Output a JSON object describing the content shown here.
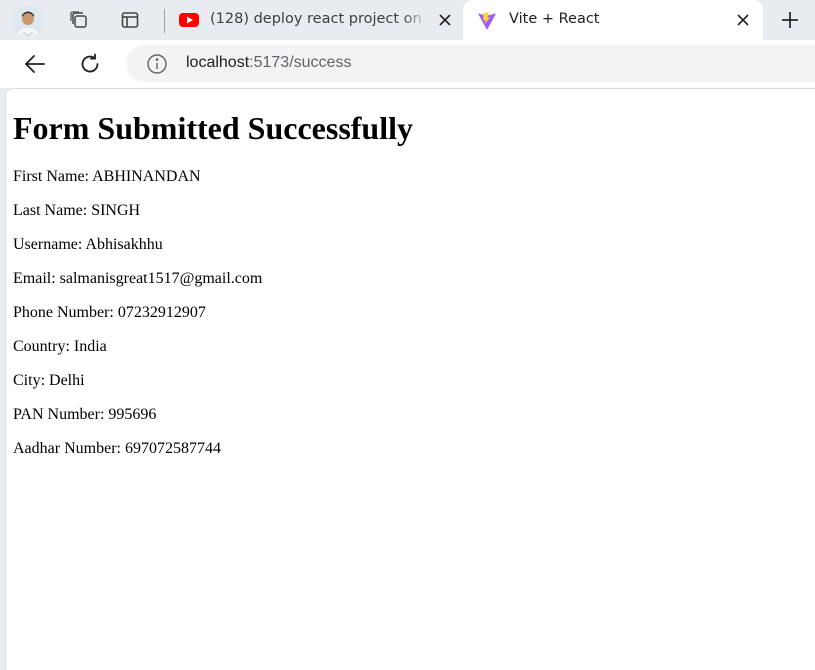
{
  "browser": {
    "tabs": [
      {
        "title": "(128) deploy react project on github pages",
        "favicon": "youtube-icon",
        "active": false
      },
      {
        "title": "Vite + React",
        "favicon": "vite-icon",
        "active": true
      }
    ],
    "address_bar": {
      "host": "localhost",
      "rest": ":5173/success"
    },
    "icons": {
      "profile": "avatar",
      "workspaces": "workspaces-icon",
      "tab_actions": "tab-actions-icon",
      "back": "back-arrow-icon",
      "reload": "reload-icon",
      "site_info": "info-icon",
      "close": "close-icon",
      "new_tab": "plus-icon"
    },
    "colors": {
      "tabstrip": "#e8ebef",
      "youtube_red": "#ff0000",
      "vite_purple": "#9d5cff",
      "vite_yellow": "#ffd62e"
    }
  },
  "page": {
    "heading": "Form Submitted Successfully",
    "fields": [
      {
        "label": "First Name",
        "value": "ABHINANDAN",
        "text": "First Name: ABHINANDAN"
      },
      {
        "label": "Last Name",
        "value": "SINGH",
        "text": "Last Name: SINGH"
      },
      {
        "label": "Username",
        "value": "Abhisakhhu",
        "text": "Username: Abhisakhhu"
      },
      {
        "label": "Email",
        "value": "salmanisgreat1517@gmail.com",
        "text": "Email: salmanisgreat1517@gmail.com"
      },
      {
        "label": "Phone Number",
        "value": "07232912907",
        "text": "Phone Number: 07232912907"
      },
      {
        "label": "Country",
        "value": "India",
        "text": "Country: India"
      },
      {
        "label": "City",
        "value": "Delhi",
        "text": "City: Delhi"
      },
      {
        "label": "PAN Number",
        "value": "995696",
        "text": "PAN Number: 995696"
      },
      {
        "label": "Aadhar Number",
        "value": "697072587744",
        "text": "Aadhar Number: 697072587744"
      }
    ]
  }
}
